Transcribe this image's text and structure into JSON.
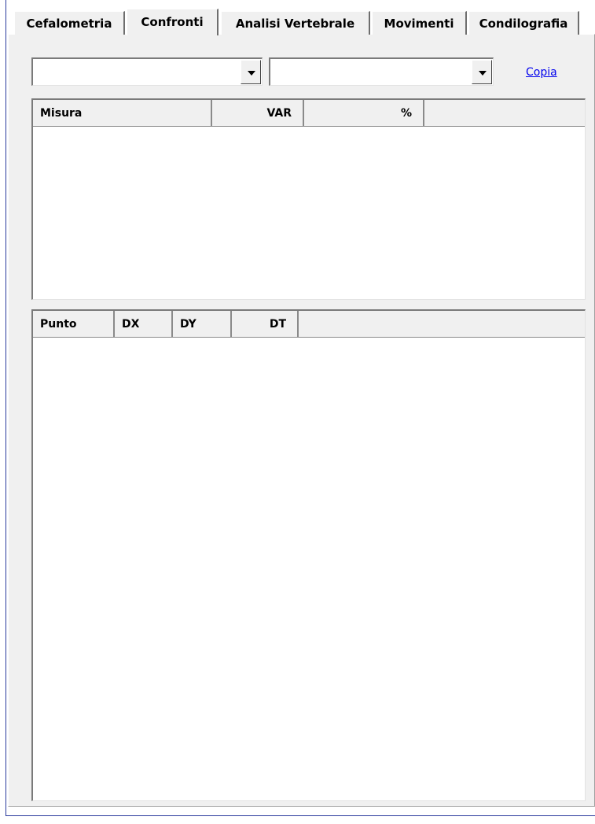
{
  "tabs": [
    {
      "label": "Cefalometria",
      "active": false
    },
    {
      "label": "Confronti",
      "active": true
    },
    {
      "label": "Analisi Vertebrale",
      "active": false
    },
    {
      "label": "Movimenti",
      "active": false
    },
    {
      "label": "Condilografia",
      "active": false
    }
  ],
  "compare": {
    "combo_left_value": "",
    "combo_right_value": "",
    "copy_link": "Copia"
  },
  "measures_table": {
    "columns": [
      "Misura",
      "VAR",
      "%"
    ],
    "rows": []
  },
  "points_table": {
    "columns": [
      "Punto",
      "DX",
      "DY",
      "DT"
    ],
    "rows": []
  }
}
